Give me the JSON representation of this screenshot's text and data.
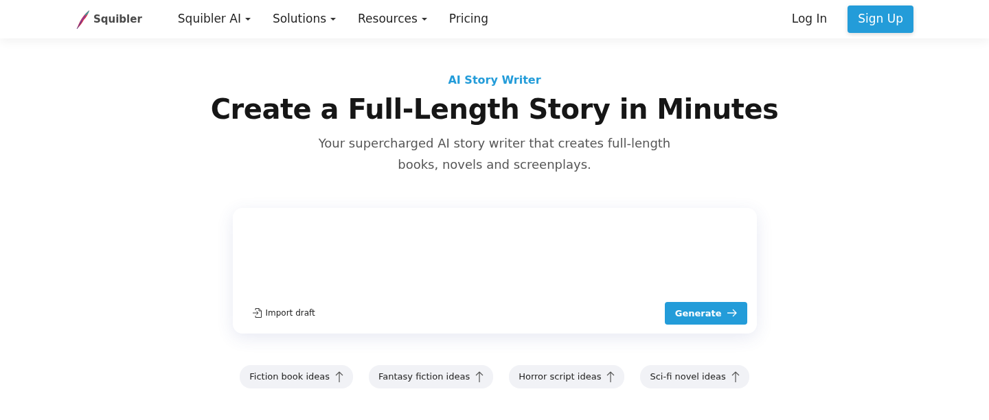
{
  "brand": {
    "name": "Squibler"
  },
  "nav": [
    {
      "label": "Squibler AI",
      "dropdown": true
    },
    {
      "label": "Solutions",
      "dropdown": true
    },
    {
      "label": "Resources",
      "dropdown": true
    },
    {
      "label": "Pricing",
      "dropdown": false
    }
  ],
  "auth": {
    "login": "Log In",
    "signup": "Sign Up"
  },
  "hero": {
    "eyebrow": "AI Story Writer",
    "title": "Create a Full-Length Story in Minutes",
    "subtitle": "Your supercharged AI story writer that creates full-length books, novels and screenplays."
  },
  "composer": {
    "import_label": "Import draft",
    "generate_label": "Generate"
  },
  "suggestions": [
    {
      "label": "Fiction book ideas"
    },
    {
      "label": "Fantasy fiction ideas"
    },
    {
      "label": "Horror script ideas"
    },
    {
      "label": "Sci-fi novel ideas"
    }
  ]
}
